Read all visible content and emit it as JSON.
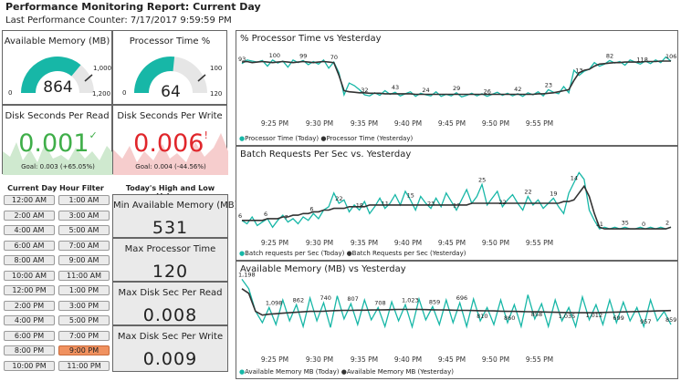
{
  "header": {
    "title": "Performance Monitoring Report: Current Day",
    "subtitle": "Last Performance Counter: 7/17/2017 9:59:59 PM"
  },
  "colors": {
    "teal": "#17b7a7",
    "dark": "#333333",
    "green": "#3fae49",
    "red": "#e0262b",
    "gaugeBg": "#e6e6e6",
    "selected": "#f0915f"
  },
  "kpis": {
    "available_memory": {
      "title": "Available Memory (MB)",
      "value": "864",
      "min": "0",
      "max": "1,200",
      "target": "1,000",
      "level": 0.72
    },
    "processor_time": {
      "title": "Processor Time %",
      "value": "64",
      "min": "0",
      "max": "120",
      "target": "100",
      "level": 0.533
    },
    "disk_read": {
      "title": "Disk Seconds Per Read",
      "value": "0.001",
      "check": "✓",
      "goal": "Goal: 0.003 (+65.05%)"
    },
    "disk_write": {
      "title": "Disk Seconds Per Write",
      "value": "0.006",
      "alert": "!",
      "goal": "Goal: 0.004 (-44.56%)"
    }
  },
  "filter": {
    "title": "Current Day Hour Filter",
    "hours": [
      "12:00 AM",
      "1:00 AM",
      "2:00 AM",
      "3:00 AM",
      "4:00 AM",
      "5:00 AM",
      "6:00 AM",
      "7:00 AM",
      "8:00 AM",
      "9:00 AM",
      "10:00 AM",
      "11:00 AM",
      "12:00 PM",
      "1:00 PM",
      "2:00 PM",
      "3:00 PM",
      "4:00 PM",
      "5:00 PM",
      "6:00 PM",
      "7:00 PM",
      "8:00 PM",
      "9:00 PM",
      "10:00 PM",
      "11:00 PM"
    ],
    "selected": "9:00 PM"
  },
  "highlow": {
    "title": "Today's High and Low Values",
    "items": [
      {
        "label": "Min Available Memory (MB)",
        "value": "531"
      },
      {
        "label": "Max Processor Time",
        "value": "120"
      },
      {
        "label": "Max Disk Sec Per Read",
        "value": "0.008"
      },
      {
        "label": "Max Disk Sec Per Write",
        "value": "0.009"
      }
    ]
  },
  "chart_data": [
    {
      "type": "line",
      "title": "% Processor Time vs Yesterday",
      "x": [
        "9:25 PM",
        "9:30 PM",
        "9:35 PM",
        "9:40 PM",
        "9:45 PM",
        "9:50 PM",
        "9:55 PM"
      ],
      "ylim": [
        0,
        130
      ],
      "series": [
        {
          "name": "Processor Time (Today)",
          "color": "#17b7a7",
          "values": [
            93,
            100,
            98,
            96,
            99,
            88,
            100,
            94,
            98,
            86,
            100,
            95,
            99,
            91,
            97,
            92,
            100,
            84,
            96,
            75,
            32,
            55,
            50,
            42,
            32,
            30,
            36,
            31,
            40,
            33,
            37,
            30,
            34,
            38,
            29,
            35,
            32,
            30,
            38,
            29,
            33,
            30,
            36,
            28,
            31,
            35,
            30,
            34,
            29,
            33,
            37,
            31,
            35,
            30,
            34,
            29,
            36,
            32,
            38,
            30,
            42,
            37,
            34,
            48,
            36,
            80,
            70,
            78,
            82,
            95,
            88,
            92,
            99,
            94,
            97,
            90,
            100,
            96,
            92,
            98,
            93,
            100,
            95,
            106,
            98
          ]
        },
        {
          "name": "Processor Time (Yesterday)",
          "color": "#333333",
          "values": [
            96,
            97,
            95,
            96,
            97,
            96,
            95,
            96,
            97,
            96,
            95,
            96,
            97,
            96,
            95,
            96,
            97,
            96,
            95,
            70,
            40,
            38,
            37,
            36,
            36,
            35,
            35,
            35,
            34,
            34,
            34,
            34,
            34,
            34,
            33,
            33,
            33,
            33,
            33,
            33,
            33,
            33,
            33,
            33,
            33,
            33,
            33,
            33,
            33,
            33,
            33,
            33,
            33,
            33,
            33,
            33,
            33,
            33,
            34,
            34,
            35,
            36,
            38,
            40,
            42,
            60,
            75,
            80,
            82,
            88,
            92,
            93,
            94,
            95,
            95,
            96,
            96,
            96,
            96,
            97,
            97,
            97,
            98,
            98,
            98
          ]
        }
      ],
      "labels": [
        "93",
        "100",
        "99",
        "70",
        "32",
        "43",
        "24",
        "29",
        "26",
        "42",
        "23",
        "13",
        "82",
        "118",
        "106"
      ]
    },
    {
      "type": "line",
      "title": "Batch Requests Per Sec vs. Yesterday",
      "x": [
        "9:25 PM",
        "9:30 PM",
        "9:35 PM",
        "9:40 PM",
        "9:45 PM",
        "9:50 PM",
        "9:55 PM"
      ],
      "ylim": [
        0,
        40
      ],
      "series": [
        {
          "name": "Batch requests per Sec (Today)",
          "color": "#17b7a7",
          "values": [
            6,
            4,
            8,
            3,
            5,
            7,
            2,
            6,
            9,
            5,
            7,
            4,
            8,
            6,
            10,
            7,
            12,
            14,
            22,
            16,
            18,
            11,
            15,
            12,
            17,
            10,
            14,
            19,
            13,
            16,
            21,
            15,
            23,
            18,
            12,
            20,
            16,
            13,
            19,
            14,
            22,
            17,
            12,
            18,
            24,
            16,
            20,
            27,
            15,
            19,
            23,
            14,
            18,
            21,
            16,
            12,
            20,
            15,
            18,
            13,
            16,
            19,
            14,
            10,
            22,
            28,
            34,
            30,
            12,
            6,
            1,
            2,
            1,
            2,
            1,
            2,
            1,
            1,
            2,
            1,
            2,
            1,
            2,
            1,
            2
          ]
        },
        {
          "name": "Batch Requests per Sec (Yesterday)",
          "color": "#333333",
          "values": [
            6,
            6,
            6,
            6,
            6,
            7,
            7,
            7,
            8,
            8,
            9,
            9,
            10,
            10,
            11,
            11,
            12,
            12,
            13,
            13,
            13,
            14,
            14,
            14,
            14,
            15,
            15,
            15,
            15,
            15,
            15,
            15,
            15,
            15,
            15,
            15,
            15,
            15,
            15,
            15,
            15,
            15,
            15,
            15,
            15,
            16,
            16,
            16,
            16,
            16,
            16,
            16,
            16,
            16,
            16,
            16,
            16,
            16,
            16,
            16,
            16,
            16,
            16,
            17,
            17,
            18,
            22,
            26,
            20,
            10,
            2,
            1,
            1,
            1,
            1,
            1,
            1,
            1,
            1,
            1,
            1,
            1,
            1,
            1,
            2
          ]
        }
      ],
      "labels": [
        "6",
        "6",
        "7",
        "6",
        "22",
        "18",
        "11",
        "15",
        "23",
        "17",
        "25",
        "22",
        "22",
        "19",
        "14",
        "11",
        "35",
        "0",
        "2"
      ]
    },
    {
      "type": "line",
      "title": "Available Memory (MB) vs Yesterday",
      "x": [
        "9:25 PM",
        "9:30 PM",
        "9:35 PM",
        "9:40 PM",
        "9:45 PM",
        "9:50 PM",
        "9:55 PM"
      ],
      "ylim": [
        500,
        1250
      ],
      "series": [
        {
          "name": "Available Memory MB (Today)",
          "color": "#17b7a7",
          "values": [
            1198,
            1098,
            862,
            740,
            900,
            720,
            980,
            760,
            930,
            700,
            1000,
            760,
            950,
            690,
            1023,
            780,
            940,
            720,
            980,
            770,
            900,
            700,
            960,
            760,
            930,
            696,
            990,
            770,
            910,
            720,
            980,
            740,
            950,
            700,
            990,
            760,
            900,
            720,
            980,
            740,
            930,
            700,
            1035,
            780,
            940,
            700,
            980,
            760,
            900,
            699,
            1012,
            770,
            930,
            720,
            980,
            740,
            957,
            760,
            900,
            700,
            980,
            760,
            859,
            720
          ]
        },
        {
          "name": "Available Memory MB (Yesterday)",
          "color": "#333333",
          "values": [
            1098,
            1050,
            860,
            820,
            830,
            835,
            840,
            845,
            850,
            855,
            860,
            860,
            862,
            865,
            868,
            870,
            870,
            872,
            872,
            874,
            875,
            876,
            878,
            880,
            880,
            880,
            880,
            878,
            876,
            875,
            874,
            872,
            870,
            870,
            868,
            866,
            865,
            864,
            862,
            860,
            860,
            858,
            856,
            855,
            854,
            852,
            850,
            848,
            847,
            846,
            845,
            845,
            846,
            848,
            850,
            852,
            854,
            856,
            858,
            860,
            862,
            864,
            866,
            868
          ]
        }
      ],
      "labels": [
        "1,198",
        "1,098",
        "862",
        "740",
        "807",
        "708",
        "1,023",
        "859",
        "696",
        "810",
        "860",
        "858",
        "1,035",
        "1,012",
        "699",
        "957",
        "859"
      ]
    }
  ],
  "charts": {
    "c1": {
      "title": "% Processor Time vs Yesterday",
      "legend1": "Processor Time (Today)",
      "legend2": "Processor Time (Yesterday)"
    },
    "c2": {
      "title": "Batch Requests Per Sec vs. Yesterday",
      "legend1": "Batch requests per Sec (Today)",
      "legend2": "Batch Requests per Sec (Yesterday)"
    },
    "c3": {
      "title": "Available Memory (MB) vs Yesterday",
      "legend1": "Available Memory MB (Today)",
      "legend2": "Available Memory MB (Yesterday)"
    },
    "ticks": [
      "9:25 PM",
      "9:30 PM",
      "9:35 PM",
      "9:40 PM",
      "9:45 PM",
      "9:50 PM",
      "9:55 PM"
    ]
  }
}
